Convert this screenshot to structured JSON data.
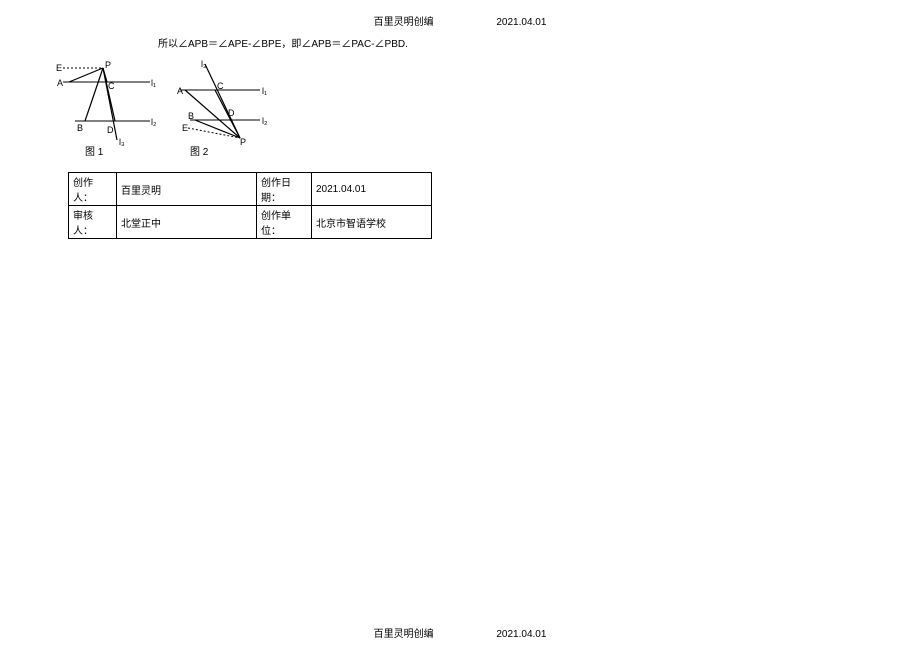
{
  "header": {
    "author_compiled": "百里灵明创编",
    "date": "2021.04.01"
  },
  "proof_text": "所以∠APB＝∠APE-∠BPE，即∠APB＝∠PAC-∠PBD.",
  "figures": {
    "fig1": {
      "caption": "图 1",
      "labels": {
        "E": "E",
        "P": "P",
        "A": "A",
        "C": "C",
        "B": "B",
        "D": "D",
        "l1": "l₁",
        "l2": "l₂",
        "l3": "l₃"
      }
    },
    "fig2": {
      "caption": "图 2",
      "labels": {
        "E": "E",
        "P": "P",
        "A": "A",
        "C": "C",
        "B": "B",
        "D": "D",
        "l1": "l₁",
        "l2": "l₂",
        "l3": "l₃"
      }
    }
  },
  "meta": {
    "row1": {
      "creator_label": "创作人：",
      "creator_value": "百里灵明",
      "date_label": "创作日期：",
      "date_value": "2021.04.01"
    },
    "row2": {
      "reviewer_label": "审核人：",
      "reviewer_value": "北堂正中",
      "unit_label": "创作单位：",
      "unit_value": "北京市智语学校"
    }
  },
  "footer": {
    "author_compiled": "百里灵明创编",
    "date": "2021.04.01"
  }
}
